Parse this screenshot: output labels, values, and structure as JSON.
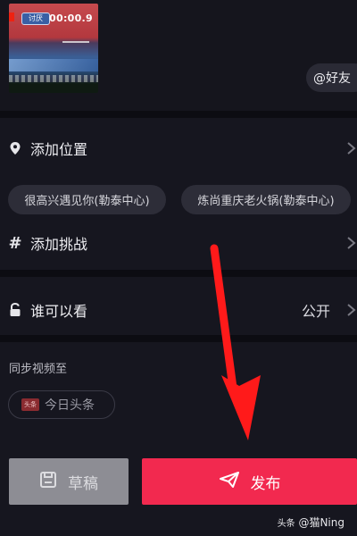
{
  "video": {
    "chip_text": "讨厌",
    "timer": "00:00.9"
  },
  "mention": {
    "label": "@好友"
  },
  "location": {
    "label": "添加位置"
  },
  "location_suggestions": [
    "很高兴遇见你(勒泰中心)",
    "炼尚重庆老火锅(勒泰中心)"
  ],
  "challenge": {
    "label": "添加挑战"
  },
  "visibility": {
    "label": "谁可以看",
    "value": "公开"
  },
  "sync": {
    "label": "同步视频至",
    "target": "今日头条",
    "logo_text": "头条"
  },
  "actions": {
    "draft": "草稿",
    "publish": "发布"
  },
  "watermark": {
    "prefix": "头条",
    "handle": "@猫Ning"
  },
  "colors": {
    "background": "#16161f",
    "publish": "#f2294f",
    "draft": "#8d8d94",
    "arrow": "#ff1a1a"
  }
}
